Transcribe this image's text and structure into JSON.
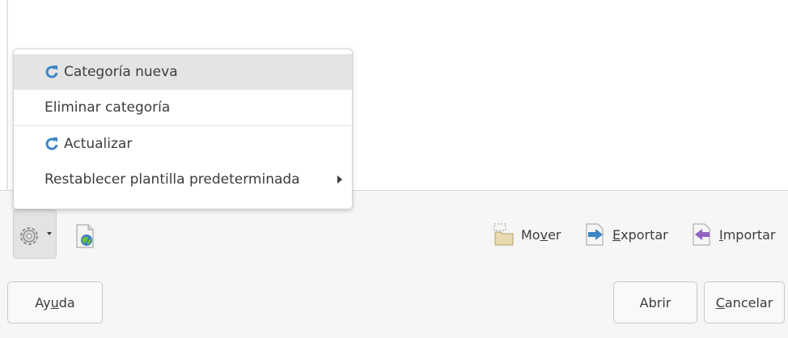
{
  "context_menu": {
    "items": [
      {
        "label": "Categoría nueva",
        "icon": "refresh-icon"
      },
      {
        "label": "Eliminar categoría"
      },
      {
        "label": "Actualizar",
        "icon": "refresh-icon"
      },
      {
        "label": "Restablecer plantilla predeterminada",
        "has_submenu": true
      }
    ]
  },
  "toolbar": {
    "move": {
      "label_pre": "Mo",
      "label_u": "v",
      "label_post": "er",
      "icon": "folder-icon"
    },
    "export": {
      "label_pre": "",
      "label_u": "E",
      "label_post": "xportar",
      "icon": "arrow-right-icon"
    },
    "import": {
      "label_pre": "",
      "label_u": "I",
      "label_post": "mportar",
      "icon": "arrow-left-icon"
    }
  },
  "buttons": {
    "help": {
      "pre": "Ay",
      "u": "u",
      "post": "da"
    },
    "open": "Abrir",
    "cancel": {
      "pre": "",
      "u": "C",
      "post": "ancelar"
    }
  },
  "colors": {
    "accent_blue": "#3d86c6",
    "import_purple": "#8f62c4"
  }
}
